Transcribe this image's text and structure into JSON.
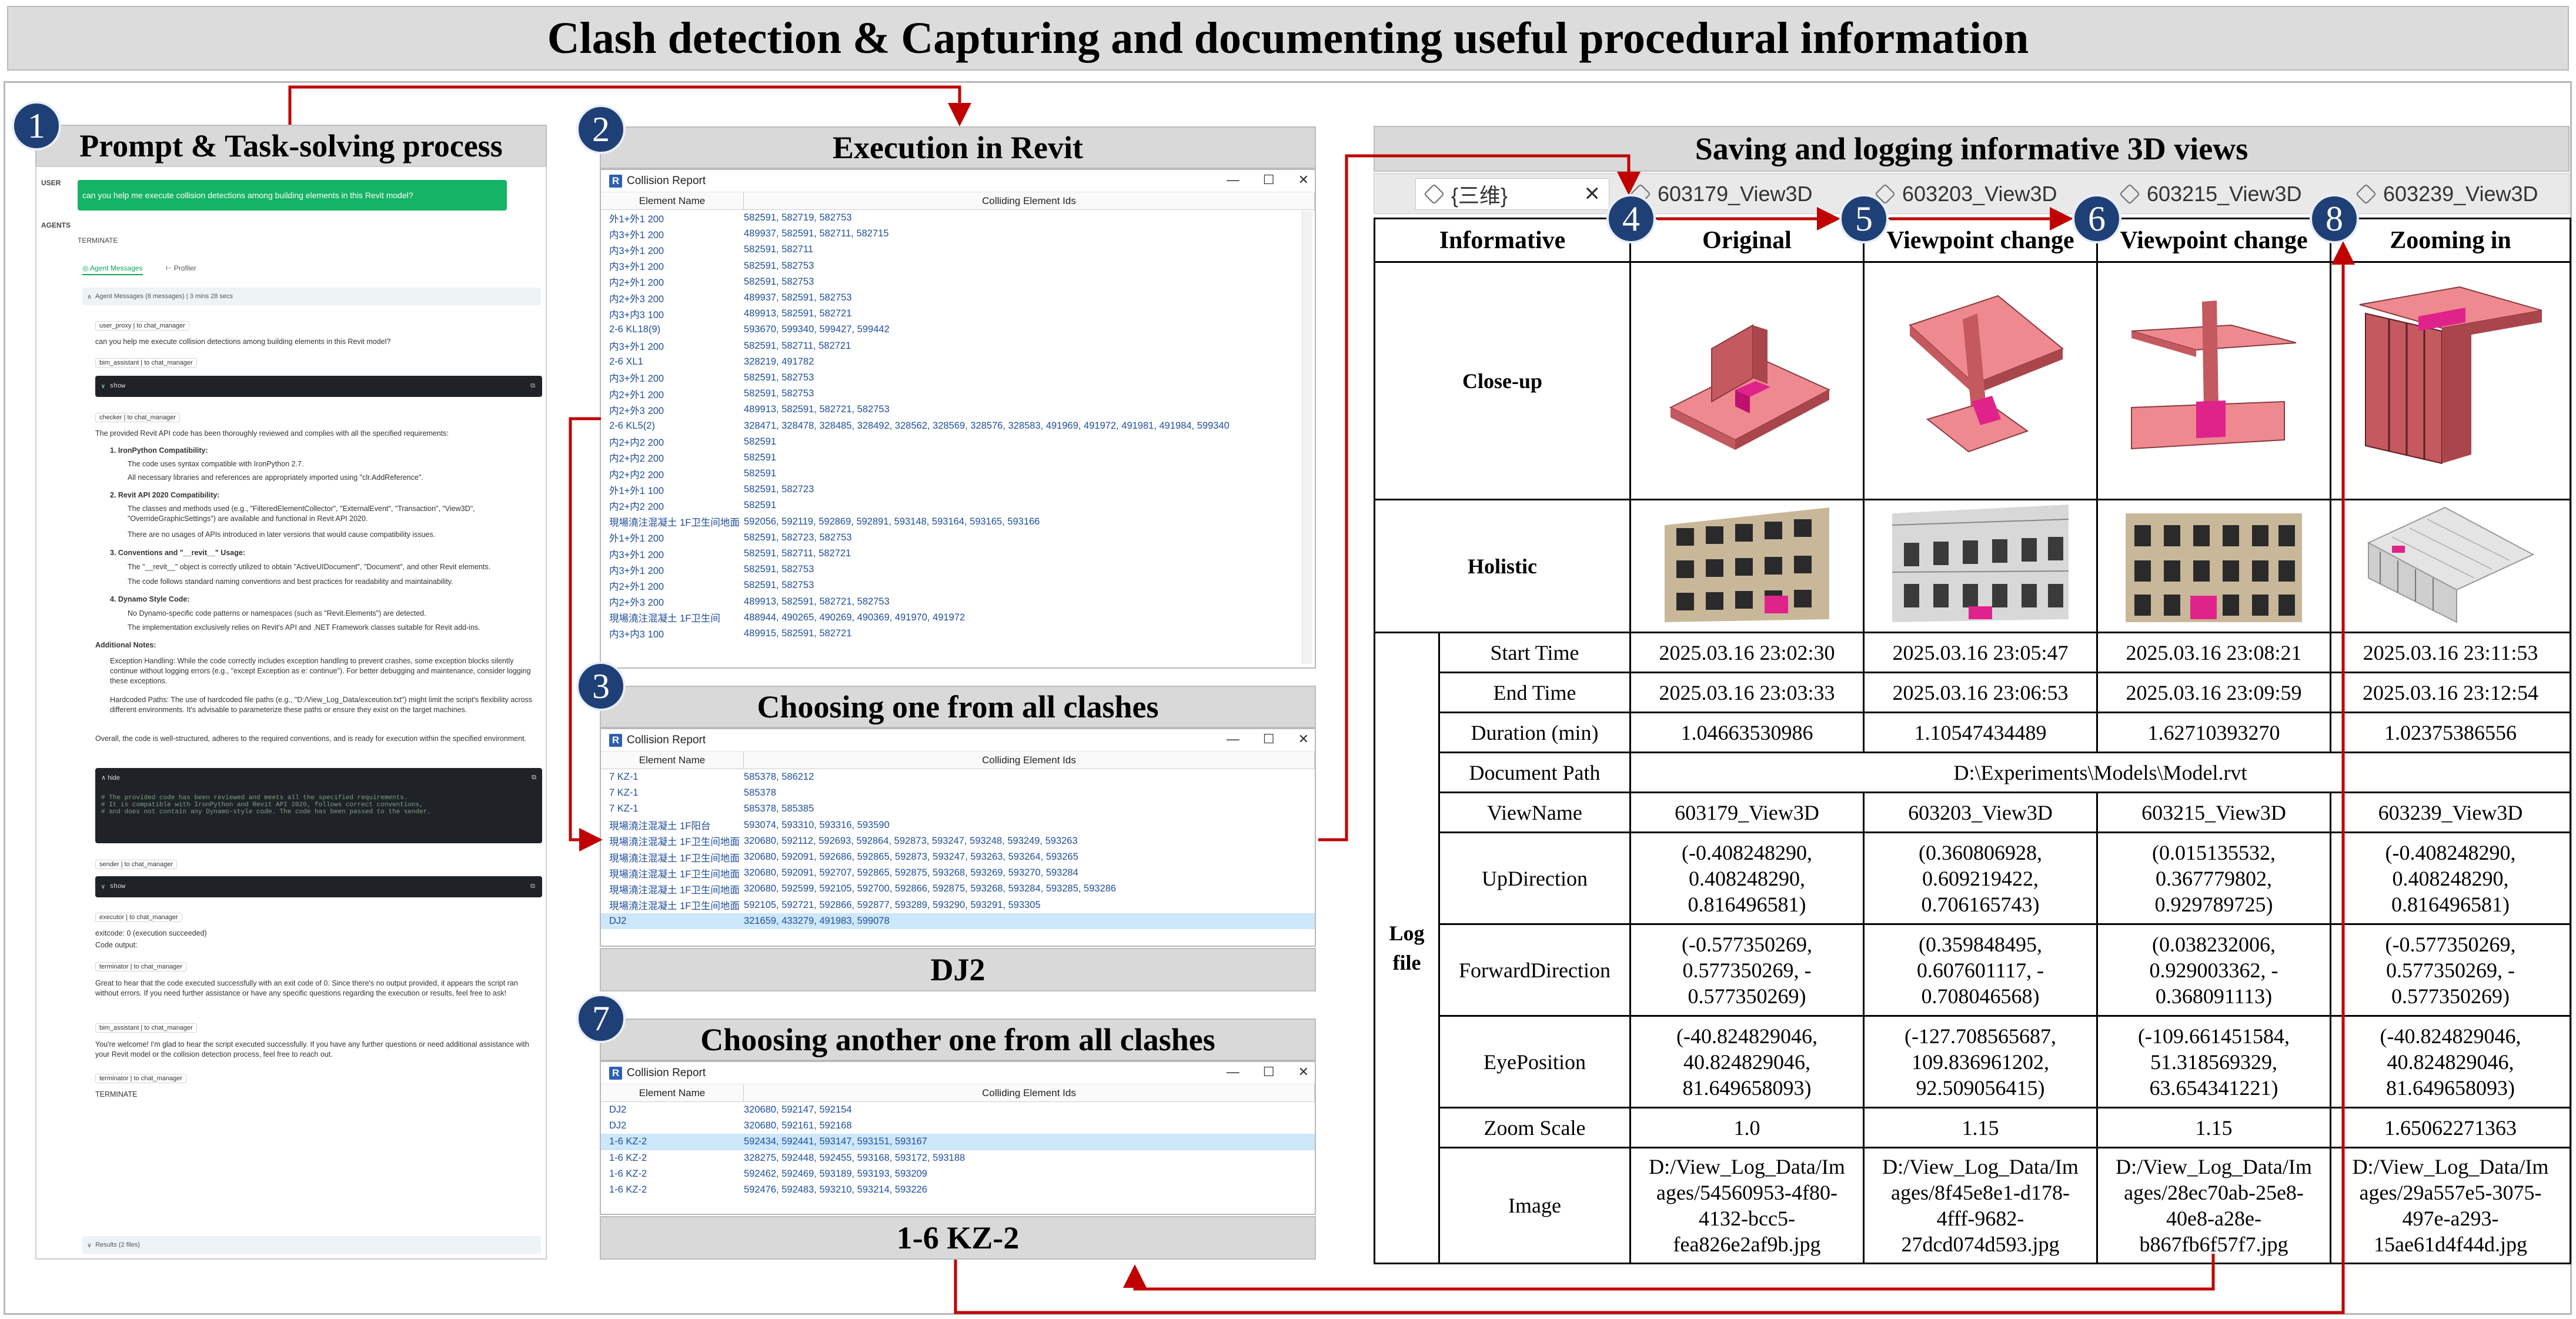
{
  "main_title": "Clash detection & Capturing and documenting useful procedural information",
  "panels": {
    "p1": {
      "num": "1",
      "title": "Prompt & Task-solving process"
    },
    "p2": {
      "num": "2",
      "title": "Execution in Revit"
    },
    "p3": {
      "num": "3",
      "title": "Choosing one from all clashes",
      "caption": "DJ2"
    },
    "p7": {
      "num": "7",
      "title": "Choosing another one from all clashes",
      "caption": "1-6 KZ-2"
    },
    "p_right": {
      "title": "Saving and logging informative 3D views"
    }
  },
  "agent": {
    "user_label": "USER",
    "user_prompt": "can you help me execute collision detections among building elements in this Revit model?",
    "agents_label": "AGENTS",
    "terminate": "TERMINATE",
    "tab_messages": "Agent Messages",
    "tab_profiler": "Profiler",
    "summary": "Agent Messages (8 messages) | 3 mins 28 secs",
    "m1_label": "user_proxy | to chat_manager",
    "m1_text": "can you help me execute collision detections among building elements in this Revit model?",
    "m2_label": "bim_assistant | to chat_manager",
    "show": "show",
    "m3_label": "checker | to chat_manager",
    "m3_intro": "The provided Revit API code has been thoroughly reviewed and complies with all the specified requirements:",
    "req1": "1. IronPython Compatibility:",
    "req1a": "The code uses syntax compatible with IronPython 2.7.",
    "req1b": "All necessary libraries and references are appropriately imported using \"clr.AddReference\".",
    "req2": "2. Revit API 2020 Compatibility:",
    "req2a": "The classes and methods used (e.g., \"FilteredElementCollector\", \"ExternalEvent\", \"Transaction\", \"View3D\", \"OverrideGraphicSettings\") are available and functional in Revit API 2020.",
    "req2b": "There are no usages of APIs introduced in later versions that would cause compatibility issues.",
    "req3": "3. Conventions and \"__revit__\" Usage:",
    "req3a": "The \"__revit__\" object is correctly utilized to obtain \"ActiveUIDocument\", \"Document\", and other Revit elements.",
    "req3b": "The code follows standard naming conventions and best practices for readability and maintainability.",
    "req4": "4. Dynamo Style Code:",
    "req4a": "No Dynamo-specific code patterns or namespaces (such as \"Revit.Elements\") are detected.",
    "req4b": "The implementation exclusively relies on Revit's API and .NET Framework classes suitable for Revit add-ins.",
    "add_notes": "Additional Notes:",
    "note1": "Exception Handling: While the code correctly includes exception handling to prevent crashes, some exception blocks silently continue without logging errors (e.g., \"except Exception as e: continue\"). For better debugging and maintenance, consider logging these exceptions.",
    "note2": "Hardcoded Paths: The use of hardcoded file paths (e.g., \"D:/View_Log_Data/exceution.txt\") might limit the script's flexibility across different environments. It's advisable to parameterize these paths or ensure they exist on the target machines.",
    "overall": "Overall, the code is well-structured, adheres to the required conventions, and is ready for execution within the specified environment.",
    "hide": "hide",
    "code1": "# The provided code has been reviewed and meets all the specified requirements.",
    "code2": "# It is compatible with IronPython and Revit API 2020, follows correct conventions,",
    "code3": "# and does not contain any Dynamo-style code. The code has been passed to the sender.",
    "m4_label": "sender | to chat_manager",
    "m5_label": "executor | to chat_manager",
    "exit1": "exitcode: 0 (execution succeeded)",
    "exit2": "Code output:",
    "m6_label": "terminator | to chat_manager",
    "m6_text": "Great to hear that the code executed successfully with an exit code of 0. Since there's no output provided, it appears the script ran without errors. If you need further assistance or have any specific questions regarding the execution or results, feel free to ask!",
    "m7_label": "bim_assistant | to chat_manager",
    "m7_text": "You're welcome! I'm glad to hear the script executed successfully. If you have any further questions or need additional assistance with your Revit model or the collision detection process, feel free to reach out.",
    "m8_label": "terminator | to chat_manager",
    "m8_text": "TERMINATE",
    "results": "Results (2 files)"
  },
  "collision_window": {
    "title": "Collision Report",
    "col1": "Element Name",
    "col2": "Colliding Element Ids"
  },
  "report_rows_2": [
    [
      "外1+外1 200",
      "582591, 582719, 582753"
    ],
    [
      "内3+外1 200",
      "489937, 582591, 582711, 582715"
    ],
    [
      "内3+外1 200",
      "582591, 582711"
    ],
    [
      "内3+外1 200",
      "582591, 582753"
    ],
    [
      "内2+外1 200",
      "582591, 582753"
    ],
    [
      "内2+外3 200",
      "489937, 582591, 582753"
    ],
    [
      "内3+内3 100",
      "489913, 582591, 582721"
    ],
    [
      "2-6 KL18(9)",
      "593670, 599340, 599427, 599442"
    ],
    [
      "内3+外1 200",
      "582591, 582711, 582721"
    ],
    [
      "2-6 XL1",
      "328219, 491782"
    ],
    [
      "内3+外1 200",
      "582591, 582753"
    ],
    [
      "内2+外1 200",
      "582591, 582753"
    ],
    [
      "内2+外3 200",
      "489913, 582591, 582721, 582753"
    ],
    [
      "2-6 KL5(2)",
      "328471, 328478, 328485, 328492, 328562, 328569, 328576, 328583, 491969, 491972, 491981, 491984, 599340"
    ],
    [
      "内2+内2 200",
      "582591"
    ],
    [
      "内2+内2 200",
      "582591"
    ],
    [
      "内2+内2 200",
      "582591"
    ],
    [
      "外1+外1 100",
      "582591, 582723"
    ],
    [
      "内2+内2 200",
      "582591"
    ],
    [
      "現場澆注混凝土 1F卫生间地面",
      "592056, 592119, 592869, 592891, 593148, 593164, 593165, 593166"
    ],
    [
      "外1+外1 200",
      "582591, 582723, 582753"
    ],
    [
      "内3+外1 200",
      "582591, 582711, 582721"
    ],
    [
      "内3+外1 200",
      "582591, 582753"
    ],
    [
      "内2+外1 200",
      "582591, 582753"
    ],
    [
      "内2+外3 200",
      "489913, 582591, 582721, 582753"
    ],
    [
      "現場澆注混凝土 1F卫生间",
      "488944, 490265, 490269, 490369, 491970, 491972"
    ],
    [
      "内3+内3 100",
      "489915, 582591, 582721"
    ]
  ],
  "report_rows_3": [
    [
      "7 KZ-1",
      "585378, 586212"
    ],
    [
      "7 KZ-1",
      "585378"
    ],
    [
      "7 KZ-1",
      "585378, 585385"
    ],
    [
      "現場澆注混凝土 1F阳台",
      "593074, 593310, 593316, 593590"
    ],
    [
      "現場澆注混凝土 1F卫生间地面",
      "320680, 592112, 592693, 592864, 592873, 593247, 593248, 593249, 593263"
    ],
    [
      "現場澆注混凝土 1F卫生间地面",
      "320680, 592091, 592686, 592865, 592873, 593247, 593263, 593264, 593265"
    ],
    [
      "現場澆注混凝土 1F卫生间地面",
      "320680, 592091, 592707, 592865, 592875, 593268, 593269, 593270, 593284"
    ],
    [
      "現場澆注混凝土 1F卫生间地面",
      "320680, 592599, 592105, 592700, 592866, 592875, 593268, 593284, 593285, 593286"
    ],
    [
      "現場澆注混凝土 1F卫生间地面",
      "592105, 592721, 592866, 592877, 593289, 593290, 593291, 593305"
    ],
    [
      "DJ2",
      "321659, 433279, 491983, 599078"
    ]
  ],
  "report_rows_7": [
    [
      "DJ2",
      "320680, 592147, 592154"
    ],
    [
      "DJ2",
      "320680, 592161, 592168"
    ],
    [
      "1-6 KZ-2",
      "592434, 592441, 593147, 593151, 593167"
    ],
    [
      "1-6 KZ-2",
      "328275, 592448, 592455, 593168, 593172, 593188"
    ],
    [
      "1-6 KZ-2",
      "592462, 592469, 593189, 593193, 593209"
    ],
    [
      "1-6 KZ-2",
      "592476, 592483, 593210, 593214, 593226"
    ]
  ],
  "tabs": [
    "{三维}",
    "603179_View3D",
    "603203_View3D",
    "603215_View3D",
    "603239_View3D"
  ],
  "table": {
    "headers": [
      "Informative",
      "Original",
      "Viewpoint change",
      "Viewpoint change",
      "Zooming in"
    ],
    "closeup": "Close-up",
    "holistic": "Holistic",
    "logfile": "Log file",
    "rows": {
      "start": {
        "label": "Start Time",
        "v": [
          "2025.03.16 23:02:30",
          "2025.03.16 23:05:47",
          "2025.03.16 23:08:21",
          "2025.03.16 23:11:53"
        ]
      },
      "end": {
        "label": "End Time",
        "v": [
          "2025.03.16 23:03:33",
          "2025.03.16 23:06:53",
          "2025.03.16 23:09:59",
          "2025.03.16 23:12:54"
        ]
      },
      "dur": {
        "label": "Duration (min)",
        "v": [
          "1.04663530986",
          "1.10547434489",
          "1.62710393270",
          "1.02375386556"
        ]
      },
      "doc": {
        "label": "Document Path",
        "v": "D:\\Experiments\\Models\\Model.rvt"
      },
      "view": {
        "label": "ViewName",
        "v": [
          "603179_View3D",
          "603203_View3D",
          "603215_View3D",
          "603239_View3D"
        ]
      },
      "up": {
        "label": "UpDirection",
        "v": [
          "(-0.408248290,\n0.408248290,\n0.816496581)",
          "(0.360806928,\n0.609219422,\n0.706165743)",
          "(0.015135532,\n0.367779802,\n0.929789725)",
          "(-0.408248290,\n0.408248290,\n0.816496581)"
        ]
      },
      "fwd": {
        "label": "ForwardDirection",
        "v": [
          "(-0.577350269,\n0.577350269, -\n0.577350269)",
          "(0.359848495,\n0.607601117, -\n0.708046568)",
          "(0.038232006,\n0.929003362, -\n0.368091113)",
          "(-0.577350269,\n0.577350269, -\n0.577350269)"
        ]
      },
      "eye": {
        "label": "EyePosition",
        "v": [
          "(-40.824829046,\n40.824829046,\n81.649658093)",
          "(-127.708565687,\n109.836961202,\n92.509056415)",
          "(-109.661451584,\n51.318569329,\n63.654341221)",
          "(-40.824829046,\n40.824829046,\n81.649658093)"
        ]
      },
      "zoom": {
        "label": "Zoom Scale",
        "v": [
          "1.0",
          "1.15",
          "1.15",
          "1.65062271363"
        ]
      },
      "image": {
        "label": "Image",
        "v": [
          "D:/View_Log_Data/Im\nages/54560953-4f80-\n4132-bcc5-\nfea826e2af9b.jpg",
          "D:/View_Log_Data/Im\nages/8f45e8e1-d178-\n4fff-9682-\n27dcd074d593.jpg",
          "D:/View_Log_Data/Im\nages/28ec70ab-25e8-\n40e8-a28e-\nb867fb6f57f7.jpg",
          "D:/View_Log_Data/Im\nages/29a557e5-3075-\n497e-a293-\n15ae61d4f44d.jpg"
        ]
      }
    }
  },
  "step_numbers": [
    "4",
    "5",
    "6",
    "8"
  ],
  "colors": {
    "accent_red": "#c00000",
    "circle_blue": "#1f3f77",
    "revit_blue": "#1f4e9b",
    "highlight": "#e0238a",
    "element_pink": "#ee8a8f"
  }
}
